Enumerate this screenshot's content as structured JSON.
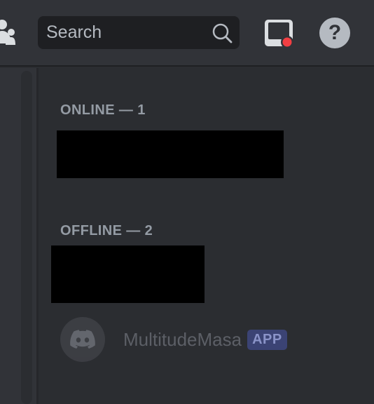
{
  "header": {
    "search_placeholder": "Search",
    "icons": {
      "people": "people-icon",
      "search": "search-icon",
      "inbox": "inbox-icon",
      "help": "help-icon"
    },
    "help_glyph": "?",
    "notification_color": "#f23f43"
  },
  "members": {
    "online_label": "ONLINE — 1",
    "offline_label": "OFFLINE — 2",
    "app_member": {
      "name": "MultitudeMasa",
      "badge": "APP",
      "avatar_icon": "discord-logo-icon"
    }
  },
  "colors": {
    "background": "#2b2d31",
    "topbar": "#313338",
    "badge_bg": "#3b4374"
  }
}
